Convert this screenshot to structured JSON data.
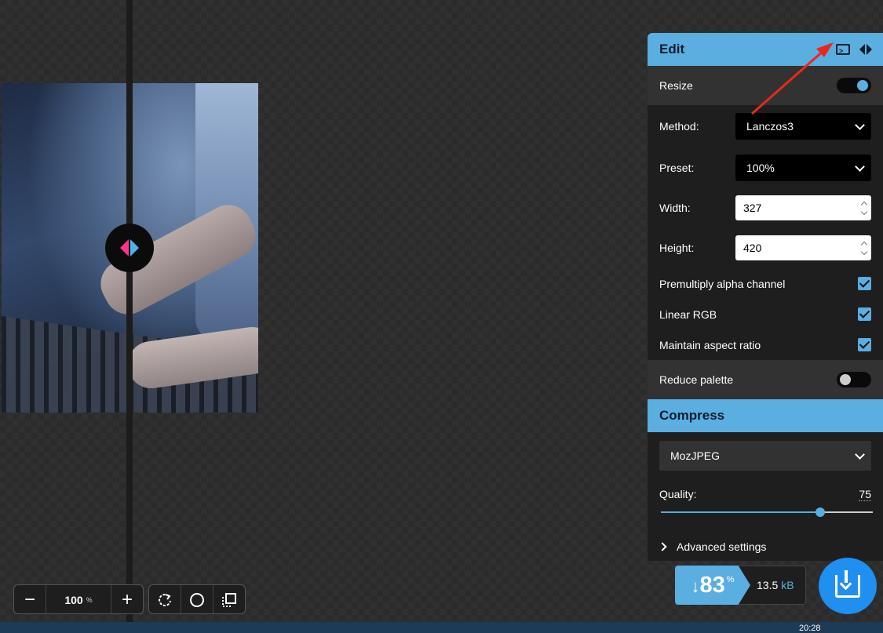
{
  "zoom": {
    "value": "100",
    "unit": "%",
    "minus": "−",
    "plus": "+"
  },
  "edit": {
    "title": "Edit",
    "resize_label": "Resize",
    "method_label": "Method:",
    "method_value": "Lanczos3",
    "preset_label": "Preset:",
    "preset_value": "100%",
    "width_label": "Width:",
    "width_value": "327",
    "height_label": "Height:",
    "height_value": "420",
    "premultiply_label": "Premultiply alpha channel",
    "linear_rgb_label": "Linear RGB",
    "aspect_label": "Maintain aspect ratio",
    "reduce_palette_label": "Reduce palette",
    "resize_on": true,
    "reduce_palette_on": false
  },
  "compress": {
    "title": "Compress",
    "codec": "MozJPEG",
    "quality_label": "Quality:",
    "quality_value": "75",
    "quality_fraction": 0.75,
    "advanced_label": "Advanced settings"
  },
  "result": {
    "savings_arrow": "↓",
    "savings_value": "83",
    "savings_unit": "%",
    "size_value": "13.5",
    "size_unit": "kB"
  },
  "taskbar": {
    "clock": "20:28"
  },
  "colors": {
    "accent": "#5aaee0",
    "panel": "#1e1e1e",
    "annotation": "#e8281f"
  }
}
